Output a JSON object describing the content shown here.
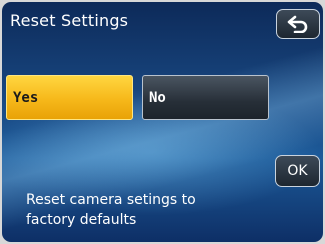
{
  "header": {
    "title": "Reset Settings",
    "back_icon": "return-arrow-icon"
  },
  "options": {
    "yes_label": "Yes",
    "no_label": "No",
    "selected": "Yes"
  },
  "confirm": {
    "ok_label": "OK"
  },
  "message": {
    "line1": "Reset camera setings to",
    "line2": "factory defaults"
  },
  "colors": {
    "selected_button": "#f6b81a",
    "background": "#1a4b86"
  }
}
